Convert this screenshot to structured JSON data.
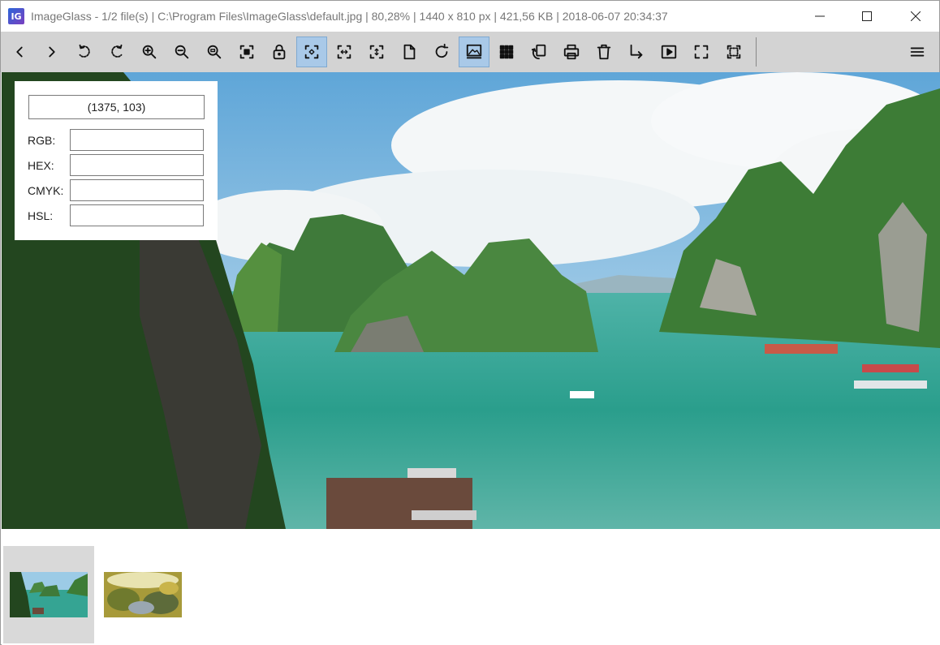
{
  "titlebar": {
    "icon_letter": "IG",
    "title": "ImageGlass - 1/2 file(s)  |  C:\\Program Files\\ImageGlass\\default.jpg  |  80,28%  |  1440 x 810 px  |  421,56 KB  |  2018-06-07 20:34:37",
    "minimize_icon": "minimize-icon",
    "maximize_icon": "maximize-icon",
    "close_icon": "close-icon"
  },
  "toolbar": {
    "buttons": [
      {
        "name": "previous-image",
        "icon": "chevron-left-icon",
        "active": false
      },
      {
        "name": "next-image",
        "icon": "chevron-right-icon",
        "active": false
      },
      {
        "name": "rotate-left",
        "icon": "rotate-left-icon",
        "active": false
      },
      {
        "name": "rotate-right",
        "icon": "rotate-right-icon",
        "active": false
      },
      {
        "name": "zoom-in",
        "icon": "zoom-in-icon",
        "active": false
      },
      {
        "name": "zoom-out",
        "icon": "zoom-out-icon",
        "active": false
      },
      {
        "name": "actual-size",
        "icon": "zoom-actual-icon",
        "active": false
      },
      {
        "name": "auto-zoom",
        "icon": "auto-zoom-icon",
        "active": false
      },
      {
        "name": "lock-zoom",
        "icon": "lock-icon",
        "active": false
      },
      {
        "name": "scale-to-fit",
        "icon": "scale-fit-icon",
        "active": true
      },
      {
        "name": "scale-to-width",
        "icon": "scale-width-icon",
        "active": false
      },
      {
        "name": "scale-to-height",
        "icon": "scale-height-icon",
        "active": false
      },
      {
        "name": "open-file",
        "icon": "file-icon",
        "active": false
      },
      {
        "name": "refresh",
        "icon": "refresh-icon",
        "active": false
      },
      {
        "name": "thumbnail-bar",
        "icon": "gallery-icon",
        "active": true
      },
      {
        "name": "checkerboard",
        "icon": "grid-icon",
        "active": false
      },
      {
        "name": "convert",
        "icon": "copy-rotate-icon",
        "active": false
      },
      {
        "name": "print",
        "icon": "print-icon",
        "active": false
      },
      {
        "name": "delete",
        "icon": "trash-icon",
        "active": false
      },
      {
        "name": "go-to",
        "icon": "arrow-turn-icon",
        "active": false
      },
      {
        "name": "slideshow",
        "icon": "play-icon",
        "active": false
      },
      {
        "name": "fullscreen",
        "icon": "fullscreen-icon",
        "active": false
      },
      {
        "name": "frameless",
        "icon": "frameless-icon",
        "active": false
      }
    ],
    "menu_icon": "hamburger-menu-icon"
  },
  "color_picker": {
    "coordinates": "(1375, 103)",
    "rows": [
      {
        "label": "RGB:",
        "value": ""
      },
      {
        "label": "HEX:",
        "value": ""
      },
      {
        "label": "CMYK:",
        "value": ""
      },
      {
        "label": "HSL:",
        "value": ""
      }
    ]
  },
  "thumbnails": [
    {
      "name": "thumbnail-default",
      "selected": true
    },
    {
      "name": "thumbnail-second",
      "selected": false
    }
  ],
  "colors": {
    "toolbar_bg": "#d3d3d3",
    "active_button_bg": "#a9c9e8",
    "sky": "#8ec3e6",
    "water": "#2a9e8c"
  }
}
